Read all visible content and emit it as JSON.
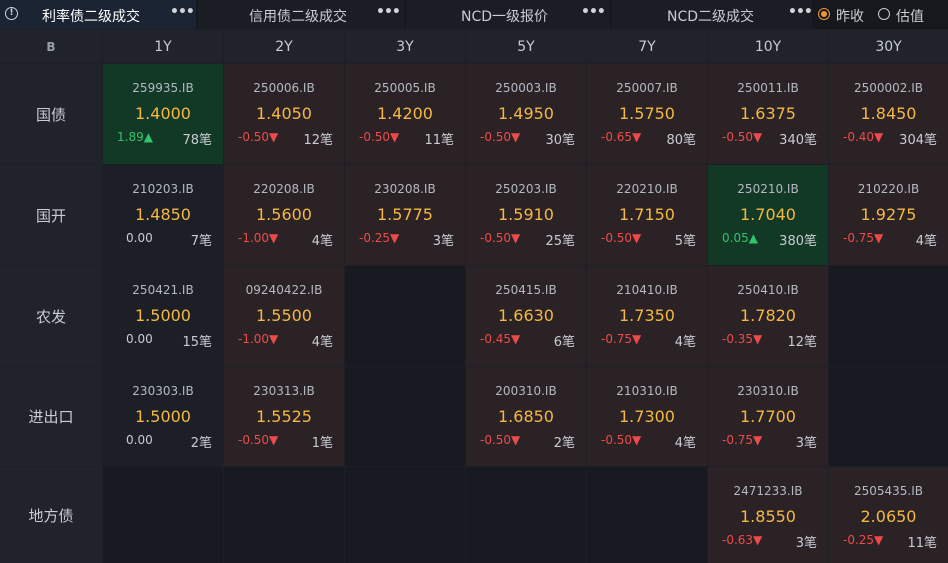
{
  "tabs": [
    {
      "label": "利率债二级成交",
      "active": true
    },
    {
      "label": "信用债二级成交",
      "active": false
    },
    {
      "label": "NCD一级报价",
      "active": false
    },
    {
      "label": "NCD二级成交",
      "active": false
    }
  ],
  "more_glyph": "•••",
  "radio": {
    "options": [
      "昨收",
      "估值"
    ],
    "selected": "昨收"
  },
  "colors": {
    "up": "#2fc56a",
    "down": "#ef4a4a",
    "price": "#f4b843",
    "radio_accent": "#f0963a"
  },
  "grid": {
    "corner_icon": "B",
    "tenors": [
      "1Y",
      "2Y",
      "3Y",
      "5Y",
      "7Y",
      "10Y",
      "30Y"
    ],
    "rows": [
      {
        "label": "国债",
        "cells": [
          {
            "code": "259935.IB",
            "price": "1.4000",
            "change": "1.89▲",
            "dir": "up",
            "count": "78笔",
            "bg": "green"
          },
          {
            "code": "250006.IB",
            "price": "1.4050",
            "change": "-0.50▼",
            "dir": "down",
            "count": "12笔",
            "bg": "red"
          },
          {
            "code": "250005.IB",
            "price": "1.4200",
            "change": "-0.50▼",
            "dir": "down",
            "count": "11笔",
            "bg": "red"
          },
          {
            "code": "250003.IB",
            "price": "1.4950",
            "change": "-0.50▼",
            "dir": "down",
            "count": "30笔",
            "bg": "red"
          },
          {
            "code": "250007.IB",
            "price": "1.5750",
            "change": "-0.65▼",
            "dir": "down",
            "count": "80笔",
            "bg": "red"
          },
          {
            "code": "250011.IB",
            "price": "1.6375",
            "change": "-0.50▼",
            "dir": "down",
            "count": "340笔",
            "bg": "red"
          },
          {
            "code": "2500002.IB",
            "price": "1.8450",
            "change": "-0.40▼",
            "dir": "down",
            "count": "304笔",
            "bg": "red"
          }
        ]
      },
      {
        "label": "国开",
        "cells": [
          {
            "code": "210203.IB",
            "price": "1.4850",
            "change": "0.00",
            "dir": "flat",
            "count": "7笔",
            "bg": "plain"
          },
          {
            "code": "220208.IB",
            "price": "1.5600",
            "change": "-1.00▼",
            "dir": "down",
            "count": "4笔",
            "bg": "red"
          },
          {
            "code": "230208.IB",
            "price": "1.5775",
            "change": "-0.25▼",
            "dir": "down",
            "count": "3笔",
            "bg": "red"
          },
          {
            "code": "250203.IB",
            "price": "1.5910",
            "change": "-0.50▼",
            "dir": "down",
            "count": "25笔",
            "bg": "red"
          },
          {
            "code": "220210.IB",
            "price": "1.7150",
            "change": "-0.50▼",
            "dir": "down",
            "count": "5笔",
            "bg": "red"
          },
          {
            "code": "250210.IB",
            "price": "1.7040",
            "change": "0.05▲",
            "dir": "up",
            "count": "380笔",
            "bg": "green"
          },
          {
            "code": "210220.IB",
            "price": "1.9275",
            "change": "-0.75▼",
            "dir": "down",
            "count": "4笔",
            "bg": "red"
          }
        ]
      },
      {
        "label": "农发",
        "cells": [
          {
            "code": "250421.IB",
            "price": "1.5000",
            "change": "0.00",
            "dir": "flat",
            "count": "15笔",
            "bg": "plain"
          },
          {
            "code": "09240422.IB",
            "price": "1.5500",
            "change": "-1.00▼",
            "dir": "down",
            "count": "4笔",
            "bg": "red"
          },
          null,
          {
            "code": "250415.IB",
            "price": "1.6630",
            "change": "-0.45▼",
            "dir": "down",
            "count": "6笔",
            "bg": "red"
          },
          {
            "code": "210410.IB",
            "price": "1.7350",
            "change": "-0.75▼",
            "dir": "down",
            "count": "4笔",
            "bg": "red"
          },
          {
            "code": "250410.IB",
            "price": "1.7820",
            "change": "-0.35▼",
            "dir": "down",
            "count": "12笔",
            "bg": "red"
          },
          null
        ]
      },
      {
        "label": "进出口",
        "cells": [
          {
            "code": "230303.IB",
            "price": "1.5000",
            "change": "0.00",
            "dir": "flat",
            "count": "2笔",
            "bg": "plain"
          },
          {
            "code": "230313.IB",
            "price": "1.5525",
            "change": "-0.50▼",
            "dir": "down",
            "count": "1笔",
            "bg": "red"
          },
          null,
          {
            "code": "200310.IB",
            "price": "1.6850",
            "change": "-0.50▼",
            "dir": "down",
            "count": "2笔",
            "bg": "red"
          },
          {
            "code": "210310.IB",
            "price": "1.7300",
            "change": "-0.50▼",
            "dir": "down",
            "count": "4笔",
            "bg": "red"
          },
          {
            "code": "230310.IB",
            "price": "1.7700",
            "change": "-0.75▼",
            "dir": "down",
            "count": "3笔",
            "bg": "red"
          },
          null
        ]
      },
      {
        "label": "地方债",
        "cells": [
          null,
          null,
          null,
          null,
          null,
          {
            "code": "2471233.IB",
            "price": "1.8550",
            "change": "-0.63▼",
            "dir": "down",
            "count": "3笔",
            "bg": "red"
          },
          {
            "code": "2505435.IB",
            "price": "2.0650",
            "change": "-0.25▼",
            "dir": "down",
            "count": "11笔",
            "bg": "red"
          }
        ]
      }
    ]
  }
}
